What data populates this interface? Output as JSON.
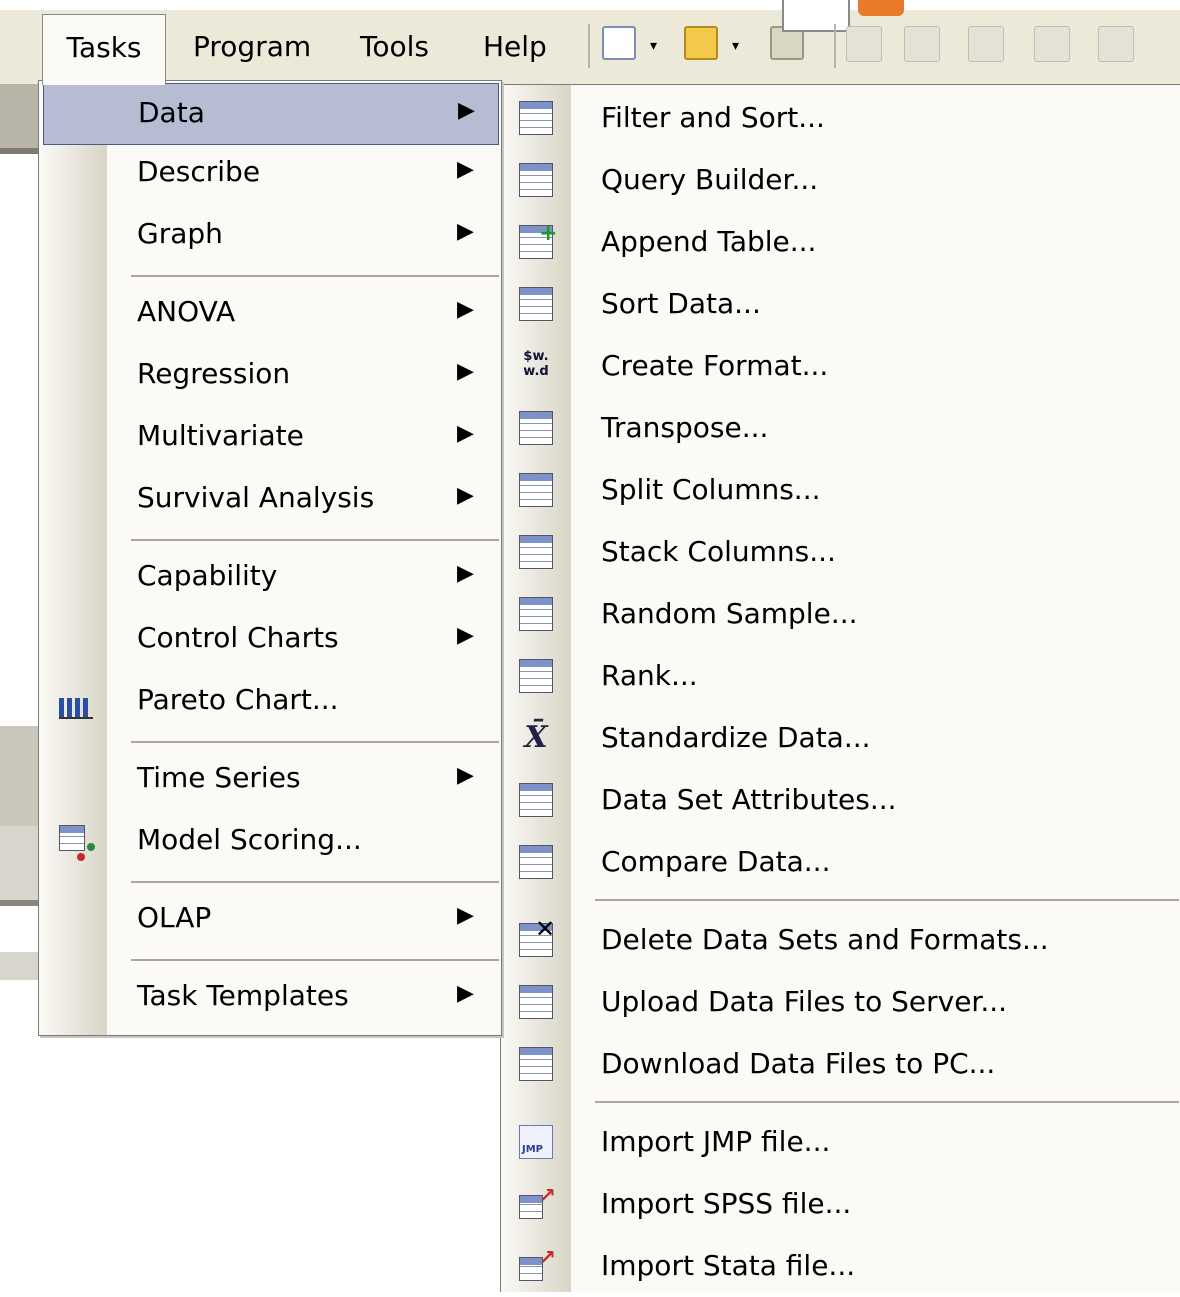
{
  "menubar": {
    "tasks": "Tasks",
    "program": "Program",
    "tools": "Tools",
    "help": "Help"
  },
  "menu_tasks": {
    "items": [
      {
        "label": "Data",
        "arrow": "▶"
      },
      {
        "label": "Describe",
        "arrow": "▶"
      },
      {
        "label": "Graph",
        "arrow": "▶"
      },
      {
        "label": "ANOVA",
        "arrow": "▶"
      },
      {
        "label": "Regression",
        "arrow": "▶"
      },
      {
        "label": "Multivariate",
        "arrow": "▶"
      },
      {
        "label": "Survival Analysis",
        "arrow": "▶"
      },
      {
        "label": "Capability",
        "arrow": "▶"
      },
      {
        "label": "Control Charts",
        "arrow": "▶"
      },
      {
        "label": "Pareto Chart..."
      },
      {
        "label": "Time Series",
        "arrow": "▶"
      },
      {
        "label": "Model Scoring..."
      },
      {
        "label": "OLAP",
        "arrow": "▶"
      },
      {
        "label": "Task Templates",
        "arrow": "▶"
      }
    ]
  },
  "menu_data": {
    "items": [
      {
        "label": "Filter and Sort..."
      },
      {
        "label": "Query Builder..."
      },
      {
        "label": "Append Table..."
      },
      {
        "label": "Sort Data..."
      },
      {
        "label": "Create Format...",
        "icon_text": "$w.\nw.d"
      },
      {
        "label": "Transpose..."
      },
      {
        "label": "Split Columns..."
      },
      {
        "label": "Stack Columns..."
      },
      {
        "label": "Random Sample..."
      },
      {
        "label": "Rank..."
      },
      {
        "label": "Standardize Data...",
        "icon_text": "X̄"
      },
      {
        "label": "Data Set Attributes..."
      },
      {
        "label": "Compare Data..."
      },
      {
        "label": "Delete Data Sets and Formats..."
      },
      {
        "label": "Upload Data Files to Server..."
      },
      {
        "label": "Download Data Files to PC..."
      },
      {
        "label": "Import JMP file...",
        "icon_text": "JMP"
      },
      {
        "label": "Import SPSS file..."
      },
      {
        "label": "Import Stata file..."
      }
    ]
  }
}
